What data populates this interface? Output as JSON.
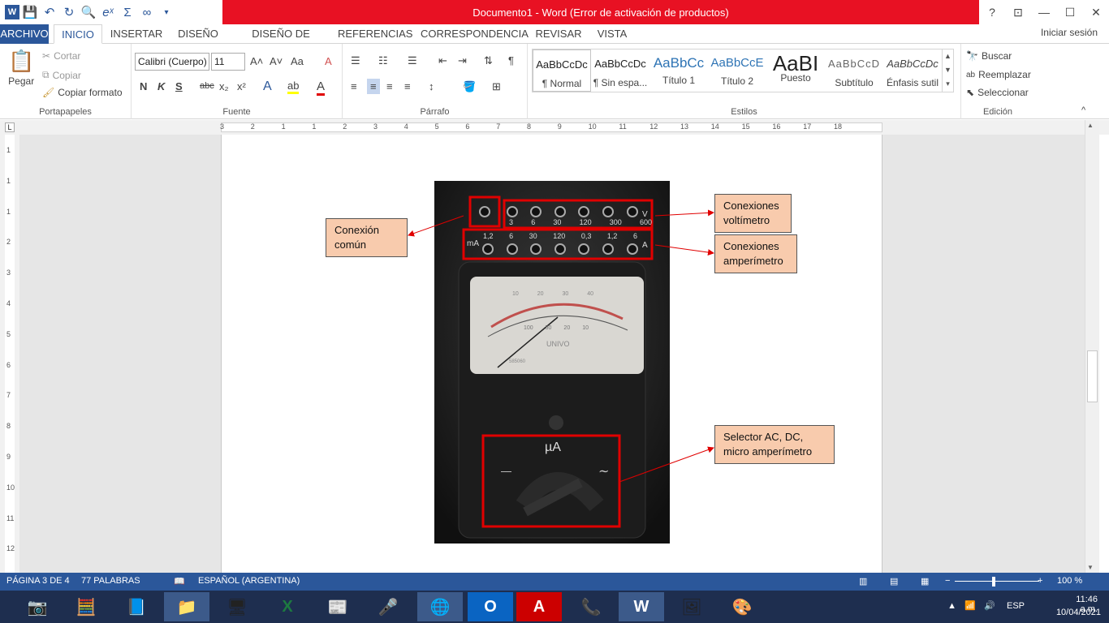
{
  "title": "Documento1 -  Word (Error de activación de productos)",
  "window_controls": {
    "help": "?",
    "restore_ribbon": "⊡",
    "minimize": "—",
    "maximize": "☐",
    "close": "✕"
  },
  "qat": {
    "word": "W",
    "save": "💾",
    "undo": "↶",
    "redo": "↻",
    "print_preview": "🔍",
    "equation": "eˣ",
    "sum": "Σ",
    "link": "∞",
    "more": "▾"
  },
  "tabs": [
    "ARCHIVO",
    "INICIO",
    "INSERTAR",
    "DISEÑO",
    "DISEÑO DE PÁGINA",
    "REFERENCIAS",
    "CORRESPONDENCIA",
    "REVISAR",
    "VISTA"
  ],
  "signin": "Iniciar sesión",
  "clipboard": {
    "paste": "Pegar",
    "cut": "Cortar",
    "copy": "Copiar",
    "format_painter": "Copiar formato",
    "label": "Portapapeles"
  },
  "font": {
    "name": "Calibri (Cuerpo)",
    "size": "11",
    "label": "Fuente",
    "bold": "N",
    "italic": "K",
    "underline": "S",
    "strike": "abc",
    "sub": "x₂",
    "sup": "x²",
    "grow": "A˄",
    "shrink": "A˅",
    "case": "Aa",
    "clear": "A"
  },
  "paragraph": {
    "label": "Párrafo",
    "pilcrow": "¶"
  },
  "styles": {
    "label": "Estilos",
    "items": [
      {
        "preview": "AaBbCcDc",
        "name": "¶ Normal"
      },
      {
        "preview": "AaBbCcDc",
        "name": "¶ Sin espa..."
      },
      {
        "preview": "AaBbCc",
        "name": "Título 1"
      },
      {
        "preview": "AaBbCcE",
        "name": "Título 2"
      },
      {
        "preview": "AaBI",
        "name": "Puesto"
      },
      {
        "preview": "AaBbCcD",
        "name": "Subtítulo"
      },
      {
        "preview": "AaBbCcDc",
        "name": "Énfasis sutil"
      }
    ]
  },
  "editing": {
    "label": "Edición",
    "find": "Buscar",
    "replace": "Reemplazar",
    "select": "Seleccionar"
  },
  "ruler_numbers": [
    "3",
    "2",
    "1",
    "1",
    "2",
    "3",
    "4",
    "5",
    "6",
    "7",
    "8",
    "9",
    "10",
    "11",
    "12",
    "13",
    "14",
    "15",
    "16",
    "17",
    "18"
  ],
  "vruler_numbers": [
    "1",
    "1",
    "1",
    "2",
    "3",
    "4",
    "5",
    "6",
    "7",
    "8",
    "9",
    "10",
    "11",
    "12"
  ],
  "callouts": {
    "comun": "Conexión común",
    "volt": "Conexiones voltímetro",
    "amp": "Conexiones amperímetro",
    "selector": "Selector AC, DC, micro amperímetro"
  },
  "meter": {
    "volt_row": [
      "3",
      "6",
      "30",
      "120",
      "300",
      "600"
    ],
    "volt_unit": "V",
    "amp_row": [
      "1,2",
      "6",
      "30",
      "120",
      "0,3",
      "1,2",
      "6"
    ],
    "amp_prefix": "mA",
    "amp_unit": "A",
    "brand": "UNIVO",
    "scale_top": [
      "10",
      "20",
      "30",
      "40"
    ],
    "scale_bottom": [
      "100",
      "50",
      "20",
      "10"
    ],
    "serial": "585060",
    "dial_label": "µA",
    "dc_mark": "—",
    "ac_mark": "∼"
  },
  "status": {
    "page": "PÁGINA 3 DE 4",
    "words": "77 PALABRAS",
    "lang": "ESPAÑOL (ARGENTINA)",
    "zoom": "100 %"
  },
  "taskbar_apps": [
    "📷",
    "🧮",
    "📘",
    "📁",
    "🖥",
    "X",
    "📰",
    "🎤",
    "🌐",
    "O",
    "A",
    "📞",
    "W",
    "🖼",
    "🎨"
  ],
  "tray": {
    "lang": "ESP",
    "time": "11:46 a.m.",
    "date": "10/04/2021"
  }
}
